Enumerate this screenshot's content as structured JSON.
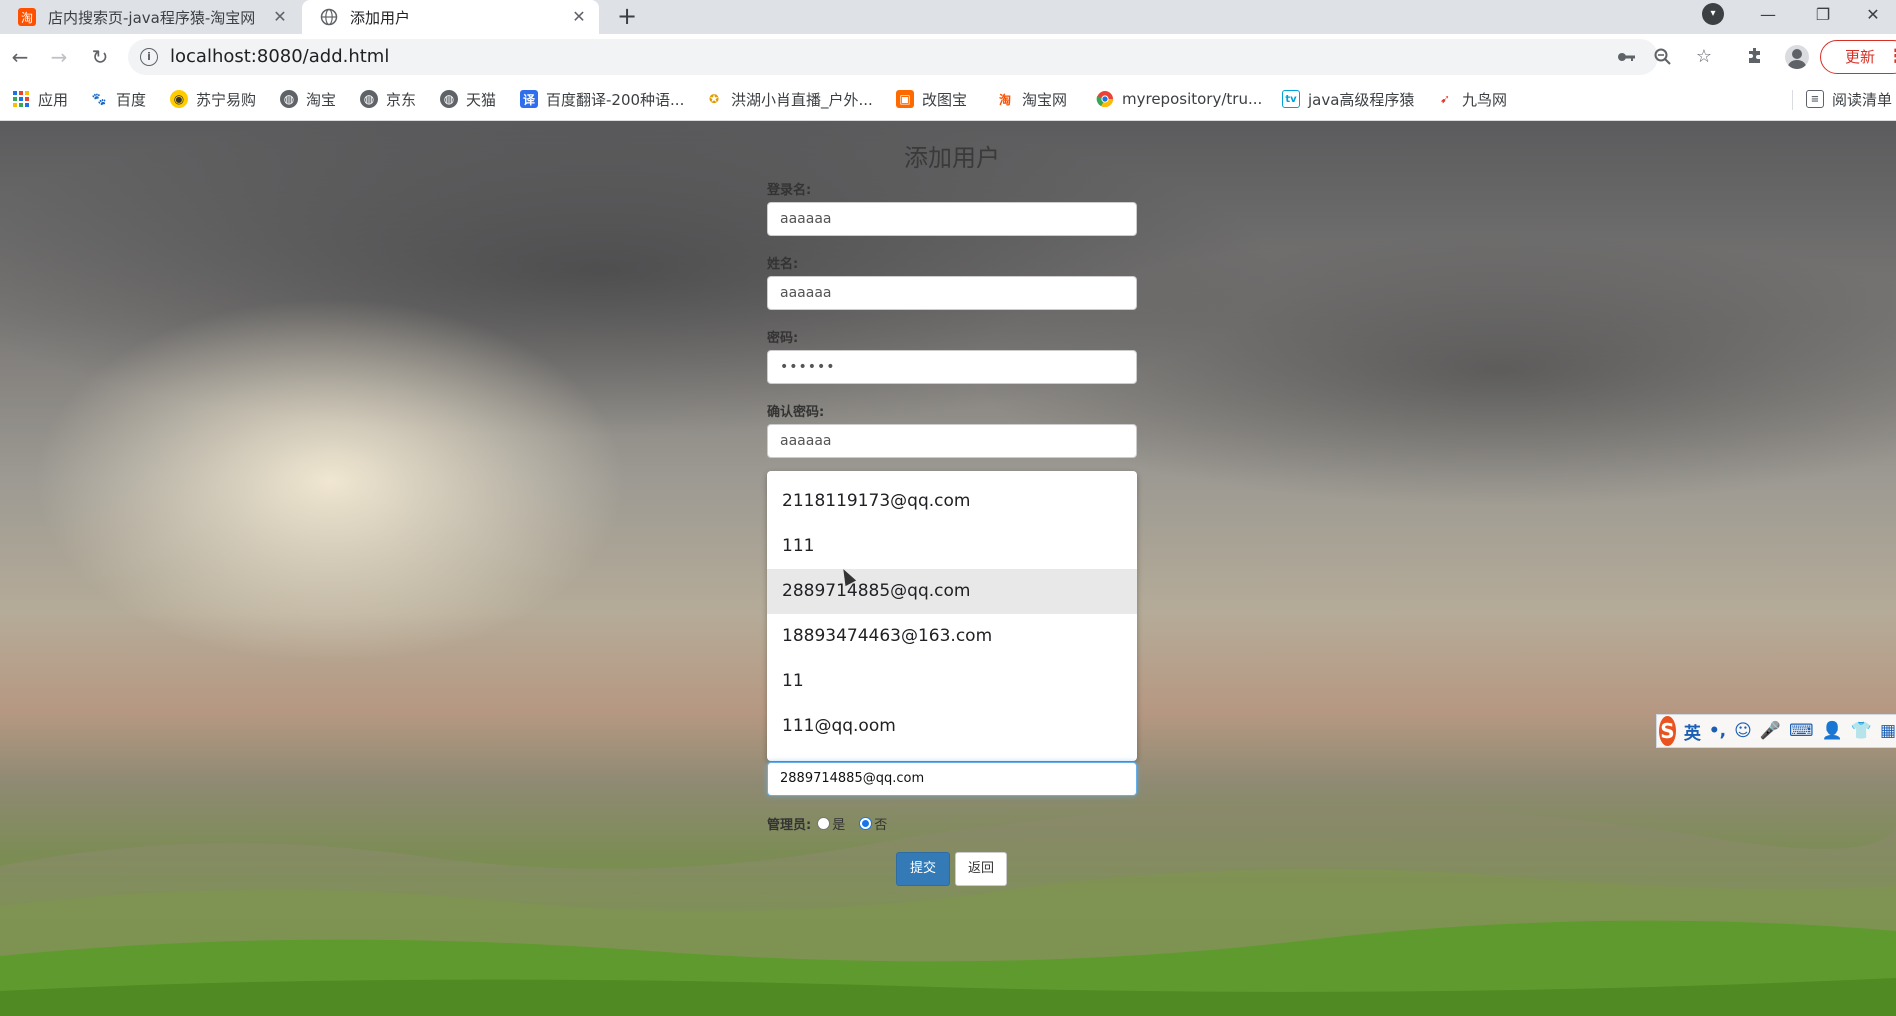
{
  "browser": {
    "tabs": [
      {
        "title": "店内搜索页-java程序猿-淘宝网",
        "active": false,
        "icon": "taobao-icon"
      },
      {
        "title": "添加用户",
        "active": true,
        "icon": "globe-icon"
      }
    ],
    "new_tab": "+",
    "url": "localhost:8080/add.html",
    "update_label": "更新"
  },
  "bookmarks": [
    {
      "label": "应用",
      "icon": "apps-grid-icon"
    },
    {
      "label": "百度",
      "icon": "baidu-paw-icon"
    },
    {
      "label": "苏宁易购",
      "icon": "suning-icon"
    },
    {
      "label": "淘宝",
      "icon": "globe-icon"
    },
    {
      "label": "京东",
      "icon": "globe-icon"
    },
    {
      "label": "天猫",
      "icon": "globe-icon"
    },
    {
      "label": "百度翻译-200种语...",
      "icon": "translate-icon"
    },
    {
      "label": "洪湖小肖直播_户外...",
      "icon": "huya-icon"
    },
    {
      "label": "改图宝",
      "icon": "gaitubao-icon"
    },
    {
      "label": "淘宝网",
      "icon": "taobao-icon"
    },
    {
      "label": "myrepository/tru...",
      "icon": "chrome-icon"
    },
    {
      "label": "java高级程序猿",
      "icon": "bilibili-icon"
    },
    {
      "label": "九鸟网",
      "icon": "bird-icon"
    },
    {
      "label": "阅读清单",
      "icon": "reading-list-icon"
    }
  ],
  "form": {
    "title": "添加用户",
    "login_label": "登录名:",
    "login_value": "aaaaaa",
    "name_label": "姓名:",
    "name_value": "aaaaaa",
    "password_label": "密码:",
    "password_value": "••••••",
    "confirm_label": "确认密码:",
    "confirm_value": "aaaaaa",
    "email_value": "2889714885@qq.com",
    "admin_label": "管理员:",
    "admin_yes": "是",
    "admin_no": "否",
    "admin_selected": "否",
    "submit_label": "提交",
    "back_label": "返回"
  },
  "autocomplete": {
    "items": [
      "2118119173@qq.com",
      "111",
      "2889714885@qq.com",
      "18893474463@163.com",
      "11",
      "111@qq.oom"
    ],
    "hovered_index": 2
  },
  "ime": {
    "logo": "S",
    "mode": "英",
    "punct": "•,"
  },
  "colors": {
    "primary_button": "#337ab7",
    "focus_border": "#66afe9",
    "update_red": "#d93025"
  }
}
